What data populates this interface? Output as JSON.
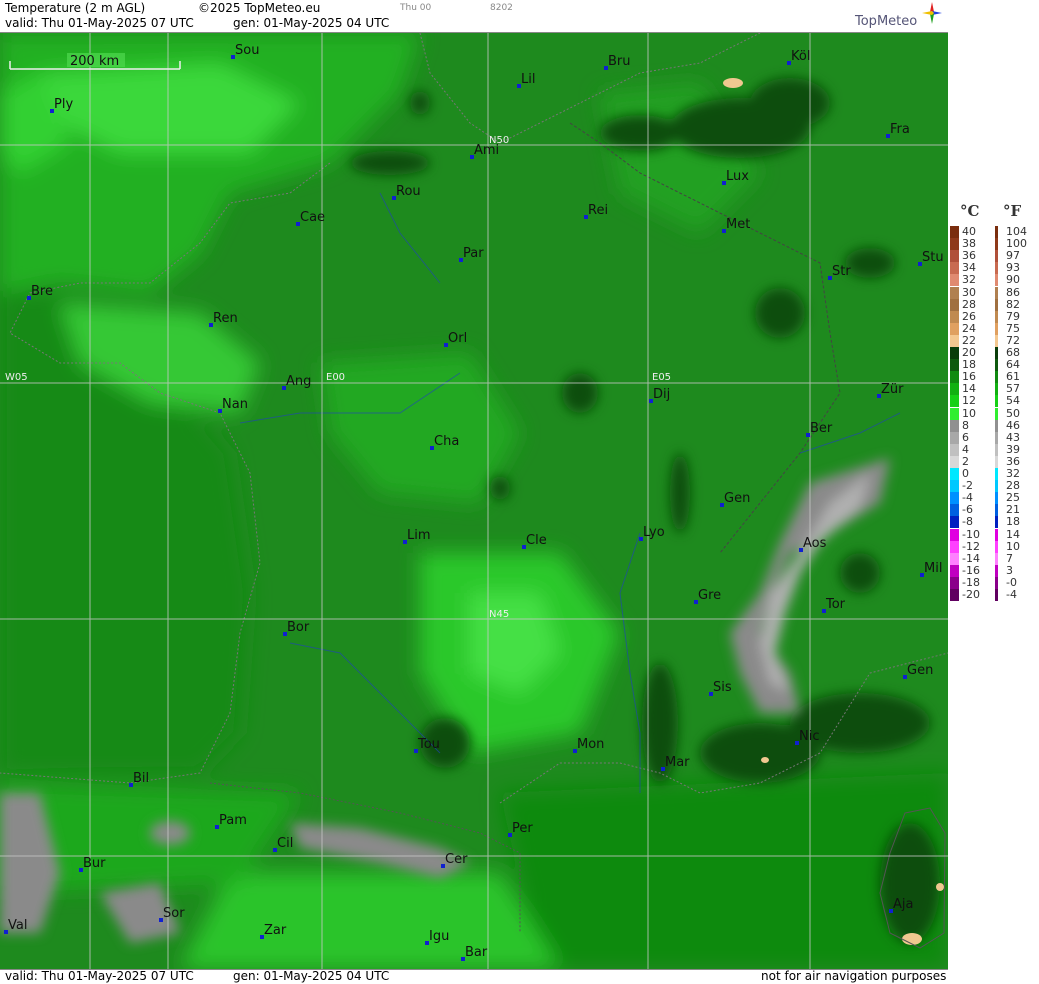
{
  "header": {
    "title": "Temperature (2 m AGL)",
    "copyright": "©2025 TopMeteo.eu",
    "day_short": "Thu 00",
    "code": "8202",
    "valid": "valid:  Thu  01-May-2025  07 UTC",
    "gen": "gen:  01-May-2025 04 UTC",
    "logo": "TopMeteo"
  },
  "footer": {
    "valid": "valid:  Thu  01-May-2025  07 UTC",
    "gen": "gen:  01-May-2025 04 UTC",
    "disclaimer": "not for air navigation purposes"
  },
  "scale": {
    "label": "200 km"
  },
  "grid_labels": {
    "w05": "W05",
    "e00": "E00",
    "e05": "E05",
    "n50": "N50",
    "n45": "N45"
  },
  "cities": {
    "sou": "Sou",
    "ply": "Ply",
    "lil": "Lil",
    "bru": "Bru",
    "kol": "Köl",
    "fra": "Fra",
    "ami": "Ami",
    "lux": "Lux",
    "rou": "Rou",
    "cae": "Cae",
    "rei": "Rei",
    "met": "Met",
    "par": "Par",
    "stu": "Stu",
    "str": "Str",
    "bre": "Bre",
    "ren": "Ren",
    "orl": "Orl",
    "ang": "Ang",
    "nan": "Nan",
    "dij": "Dij",
    "zur": "Zür",
    "ber": "Ber",
    "cha": "Cha",
    "gen": "Gen",
    "lim": "Lim",
    "cle": "Cle",
    "lyo": "Lyo",
    "aos": "Aos",
    "mil": "Mil",
    "gre": "Gre",
    "tor": "Tor",
    "bor": "Bor",
    "sis": "Sis",
    "gen2": "Gen",
    "tou": "Tou",
    "mon": "Mon",
    "mar": "Mar",
    "nic": "Nic",
    "bil": "Bil",
    "pam": "Pam",
    "per": "Per",
    "cil": "Cil",
    "cer": "Cer",
    "bur": "Bur",
    "aja": "Aja",
    "sor": "Sor",
    "val": "Val",
    "zar": "Zar",
    "igu": "Igu",
    "bar": "Bar"
  },
  "legend": {
    "celsius_unit": "°C",
    "fahrenheit_unit": "°F",
    "celsius": [
      "40",
      "38",
      "36",
      "34",
      "32",
      "30",
      "28",
      "26",
      "24",
      "22",
      "20",
      "18",
      "16",
      "14",
      "12",
      "10",
      "8",
      "6",
      "4",
      "2",
      "0",
      "-2",
      "-4",
      "-6",
      "-8",
      "-10",
      "-12",
      "-14",
      "-16",
      "-18",
      "-20"
    ],
    "fahrenheit": [
      "104",
      "100",
      "97",
      "93",
      "90",
      "86",
      "82",
      "79",
      "75",
      "72",
      "68",
      "64",
      "61",
      "57",
      "54",
      "50",
      "46",
      "43",
      "39",
      "36",
      "32",
      "28",
      "25",
      "21",
      "18",
      "14",
      "10",
      "7",
      "3",
      "-0",
      "-4"
    ],
    "colors": [
      "#7a2e0e",
      "#8e3a1a",
      "#b0503a",
      "#c86a50",
      "#e08a70",
      "#b08050",
      "#a07040",
      "#c08a50",
      "#e0a060",
      "#f4c890",
      "#0a3d0a",
      "#0e5a0e",
      "#108a10",
      "#12b012",
      "#16d016",
      "#30ee30",
      "#909090",
      "#a8a8a8",
      "#c0c0c0",
      "#d8d8d8",
      "#00e8ff",
      "#00c8ff",
      "#0090ff",
      "#0060e0",
      "#0020c0",
      "#e000e0",
      "#ff40ff",
      "#ff80ff",
      "#c000c0",
      "#8a008a",
      "#600060"
    ]
  }
}
